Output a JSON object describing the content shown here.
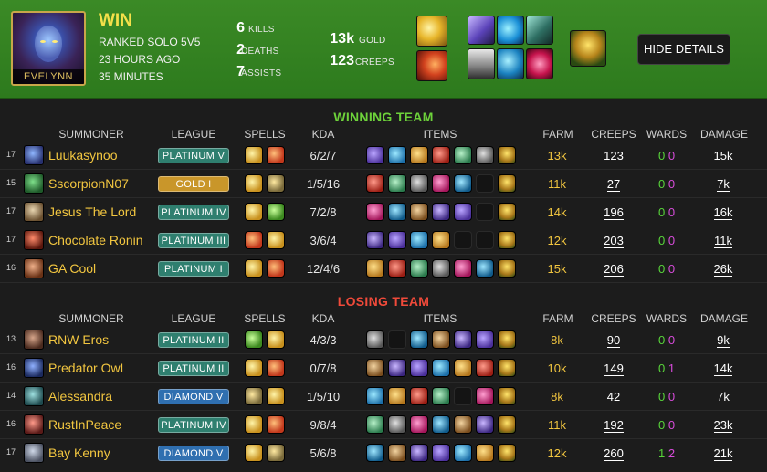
{
  "header": {
    "champion": "EVELYNN",
    "result": "WIN",
    "queue": "RANKED SOLO 5V5",
    "time_ago": "23 HOURS AGO",
    "duration": "35 MINUTES",
    "kills": "6",
    "kills_label": "KILLS",
    "deaths": "2",
    "deaths_label": "DEATHS",
    "assists": "7",
    "assists_label": "ASSISTS",
    "gold": "13k",
    "gold_label": "GOLD",
    "creeps": "123",
    "creeps_label": "CREEPS",
    "hide_button": "HIDE DETAILS"
  },
  "columns": {
    "summoner": "SUMMONER",
    "league": "LEAGUE",
    "spells": "SPELLS",
    "kda": "KDA",
    "items": "ITEMS",
    "farm": "FARM",
    "creeps": "CREEPS",
    "wards": "WARDS",
    "damage": "DAMAGE"
  },
  "winning_team": {
    "title": "WINNING TEAM",
    "players": [
      {
        "level": "17",
        "name": "Luukasynoo",
        "league": "PLATINUM V",
        "kda": "6/2/7",
        "farm": "13k",
        "creeps": "123",
        "wards_a": "0",
        "wards_b": "0",
        "damage": "15k"
      },
      {
        "level": "15",
        "name": "SscorpionN07",
        "league": "GOLD I",
        "kda": "1/5/16",
        "farm": "11k",
        "creeps": "27",
        "wards_a": "0",
        "wards_b": "0",
        "damage": "7k"
      },
      {
        "level": "17",
        "name": "Jesus The Lord",
        "league": "PLATINUM IV",
        "kda": "7/2/8",
        "farm": "14k",
        "creeps": "196",
        "wards_a": "0",
        "wards_b": "0",
        "damage": "16k"
      },
      {
        "level": "17",
        "name": "Chocolate Ronin",
        "league": "PLATINUM III",
        "kda": "3/6/4",
        "farm": "12k",
        "creeps": "203",
        "wards_a": "0",
        "wards_b": "0",
        "damage": "11k"
      },
      {
        "level": "16",
        "name": "GA Cool",
        "league": "PLATINUM I",
        "kda": "12/4/6",
        "farm": "15k",
        "creeps": "206",
        "wards_a": "0",
        "wards_b": "0",
        "damage": "26k"
      }
    ]
  },
  "losing_team": {
    "title": "LOSING TEAM",
    "players": [
      {
        "level": "13",
        "name": "RNW Eros",
        "league": "PLATINUM II",
        "kda": "4/3/3",
        "farm": "8k",
        "creeps": "90",
        "wards_a": "0",
        "wards_b": "0",
        "damage": "9k"
      },
      {
        "level": "16",
        "name": "Predator OwL",
        "league": "PLATINUM II",
        "kda": "0/7/8",
        "farm": "10k",
        "creeps": "149",
        "wards_a": "0",
        "wards_b": "1",
        "damage": "14k"
      },
      {
        "level": "14",
        "name": "Alessandra",
        "league": "DIAMOND V",
        "kda": "1/5/10",
        "farm": "8k",
        "creeps": "42",
        "wards_a": "0",
        "wards_b": "0",
        "damage": "7k"
      },
      {
        "level": "16",
        "name": "RustInPeace",
        "league": "PLATINUM IV",
        "kda": "9/8/4",
        "farm": "11k",
        "creeps": "192",
        "wards_a": "0",
        "wards_b": "0",
        "damage": "23k"
      },
      {
        "level": "17",
        "name": "Bay Kenny",
        "league": "DIAMOND V",
        "kda": "5/6/8",
        "farm": "12k",
        "creeps": "260",
        "wards_a": "1",
        "wards_b": "2",
        "damage": "21k"
      }
    ]
  },
  "colors": {
    "win_green": "#6dd23a",
    "lose_red": "#f04a3a",
    "name_gold": "#f2c640",
    "platinum_badge": "#2f7f6f",
    "gold_badge": "#c9962a",
    "diamond_badge": "#2f6fb0",
    "header_green": "#3b8a26"
  }
}
